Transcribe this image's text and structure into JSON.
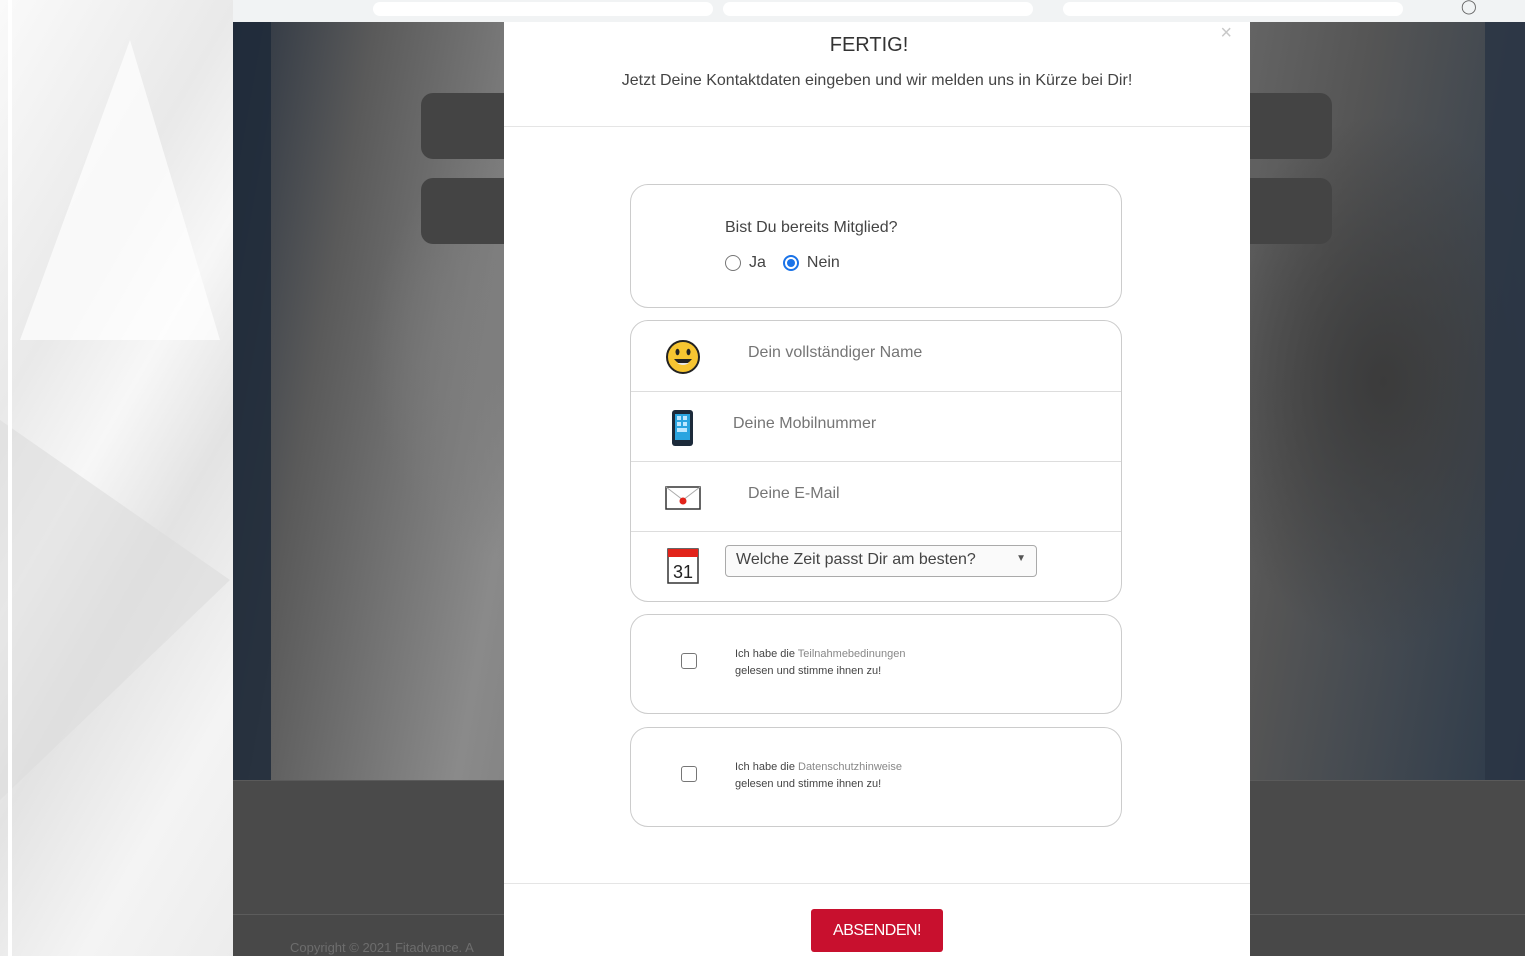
{
  "modal": {
    "close": "×",
    "title": "FERTIG!",
    "subtitle": "Jetzt Deine Kontaktdaten eingeben und wir melden uns in Kürze bei Dir!",
    "member_question": "Bist Du bereits Mitglied?",
    "radio_options": [
      {
        "label": "Ja",
        "checked": false
      },
      {
        "label": "Nein",
        "checked": true
      }
    ],
    "fields": {
      "name_placeholder": "Dein vollständiger Name",
      "mobile_placeholder": "Deine Mobilnummer",
      "email_placeholder": "Deine E-Mail",
      "time_select": "Welche Zeit passt Dir am besten?",
      "calendar_day": "31"
    },
    "consents": [
      {
        "prefix": "Ich habe die ",
        "link": "Teilnahmebedinungen",
        "suffix": "gelesen und stimme ihnen zu!"
      },
      {
        "prefix": "Ich habe die ",
        "link": "Datenschutzhinweise",
        "suffix": "gelesen und stimme ihnen zu!"
      }
    ],
    "submit_label": "ABSENDEN!"
  },
  "footer": {
    "copyright": "Copyright © 2021 Fitadvance. A"
  },
  "colors": {
    "submit": "#c8102e",
    "radio_checked": "#1a73e8"
  }
}
